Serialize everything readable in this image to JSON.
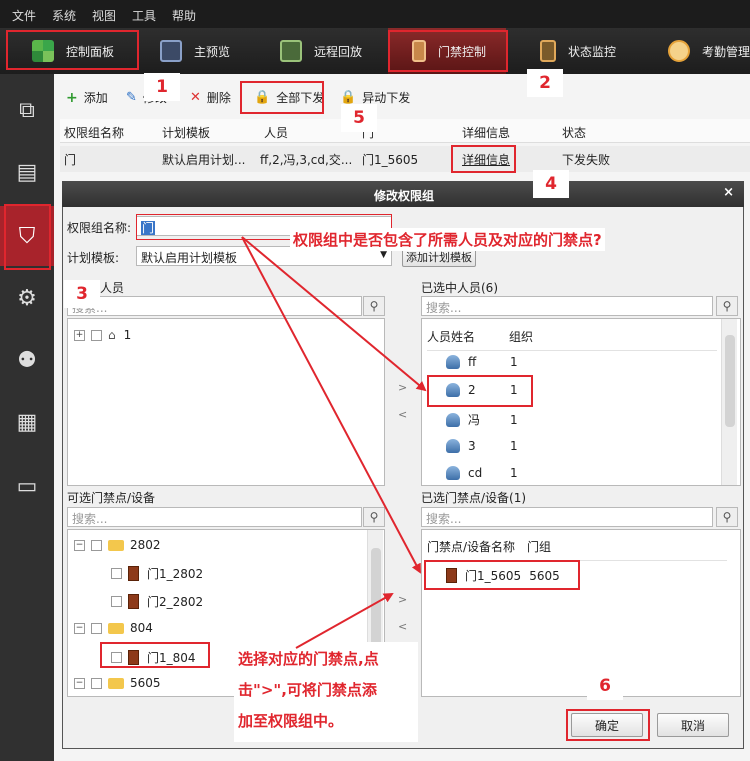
{
  "menu": [
    "文件",
    "系统",
    "视图",
    "工具",
    "帮助"
  ],
  "toolbar": [
    {
      "label": "控制面板",
      "icon": "grid-icon",
      "color": "#3aa64a"
    },
    {
      "label": "主预览",
      "icon": "camera-icon",
      "color": "#6a7fa6"
    },
    {
      "label": "远程回放",
      "icon": "playback-icon",
      "color": "#7aa65a"
    },
    {
      "label": "门禁控制",
      "icon": "door-icon",
      "color": "#c8884a"
    },
    {
      "label": "状态监控",
      "icon": "status-icon",
      "color": "#b07a3a"
    },
    {
      "label": "考勤管理",
      "icon": "attendance-icon",
      "color": "#e6a33a"
    }
  ],
  "actions": {
    "add": "添加",
    "edit": "修改",
    "delete": "删除",
    "issue_all": "全部下发",
    "issue_diff": "异动下发"
  },
  "grid": {
    "headers": [
      "权限组名称",
      "计划模板",
      "人员",
      "门",
      "详细信息",
      "状态"
    ],
    "row": [
      "门",
      "默认启用计划...",
      "ff,2,冯,3,cd,交...",
      "门1_5605",
      "详细信息",
      "下发失败"
    ]
  },
  "dialog": {
    "title": "修改权限组",
    "name_label": "权限组名称:",
    "name_value": "门",
    "template_label": "计划模板:",
    "template_value": "默认启用计划模板",
    "add_template_button": "添加计划模板",
    "persons_label": "人员",
    "search_placeholder": "搜索...",
    "person_tree_root": "1",
    "selected_persons_label": "已选中人员(6)",
    "selected_headers": [
      "人员姓名",
      "组织"
    ],
    "selected_persons": [
      {
        "name": "ff",
        "org": "1"
      },
      {
        "name": "2",
        "org": "1"
      },
      {
        "name": "冯",
        "org": "1"
      },
      {
        "name": "3",
        "org": "1"
      },
      {
        "name": "cd",
        "org": "1"
      }
    ],
    "doors_label": "可选门禁点/设备",
    "door_tree": [
      {
        "label": "2802",
        "type": "folder"
      },
      {
        "label": "门1_2802",
        "type": "door"
      },
      {
        "label": "门2_2802",
        "type": "door"
      },
      {
        "label": "804",
        "type": "folder"
      },
      {
        "label": "门1_804",
        "type": "door"
      },
      {
        "label": "5605",
        "type": "folder"
      }
    ],
    "selected_doors_label": "已选门禁点/设备(1)",
    "selected_door_headers": [
      "门禁点/设备名称",
      "门组"
    ],
    "selected_doors": [
      {
        "name": "门1_5605",
        "group": "5605"
      }
    ],
    "ok_button": "确定",
    "cancel_button": "取消"
  },
  "annotations": {
    "numbers": [
      "1",
      "2",
      "3",
      "4",
      "5",
      "6"
    ],
    "question": "权限组中是否包含了所需人员及对应的门禁点?",
    "instruction_line1": "选择对应的门禁点,点",
    "instruction_line2": "击\">\",可将门禁点添",
    "instruction_line3": "加至权限组中。",
    "accent_color": "#e0262e"
  }
}
